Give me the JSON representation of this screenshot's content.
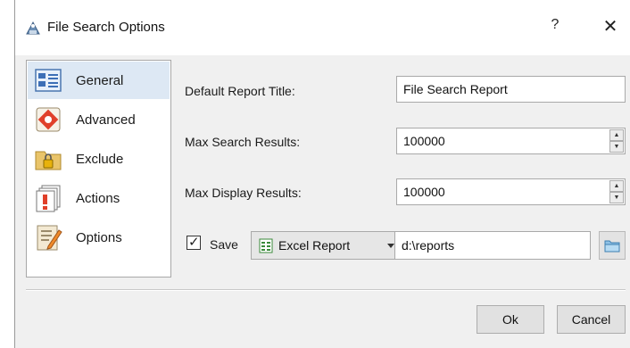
{
  "window": {
    "title": "File Search Options",
    "help_glyph": "?",
    "close_glyph": "✕",
    "title_icon": "app-icon"
  },
  "sidebar": {
    "items": [
      {
        "label": "General",
        "icon": "general-icon",
        "selected": true
      },
      {
        "label": "Advanced",
        "icon": "advanced-icon",
        "selected": false
      },
      {
        "label": "Exclude",
        "icon": "exclude-icon",
        "selected": false
      },
      {
        "label": "Actions",
        "icon": "actions-icon",
        "selected": false
      },
      {
        "label": "Options",
        "icon": "options-icon",
        "selected": false
      }
    ]
  },
  "form": {
    "report_title_label": "Default Report Title:",
    "report_title_value": "File Search Report",
    "max_search_label": "Max Search Results:",
    "max_search_value": "100000",
    "max_display_label": "Max Display Results:",
    "max_display_value": "100000",
    "save_label": "Save",
    "save_checked": true,
    "check_glyph": "✓",
    "format_value": "Excel Report",
    "path_value": "d:\\reports"
  },
  "buttons": {
    "ok_label": "Ok",
    "cancel_label": "Cancel"
  },
  "colors": {
    "selected_item_bg": "#dde8f4",
    "dialog_bg": "#f0f0f0"
  }
}
